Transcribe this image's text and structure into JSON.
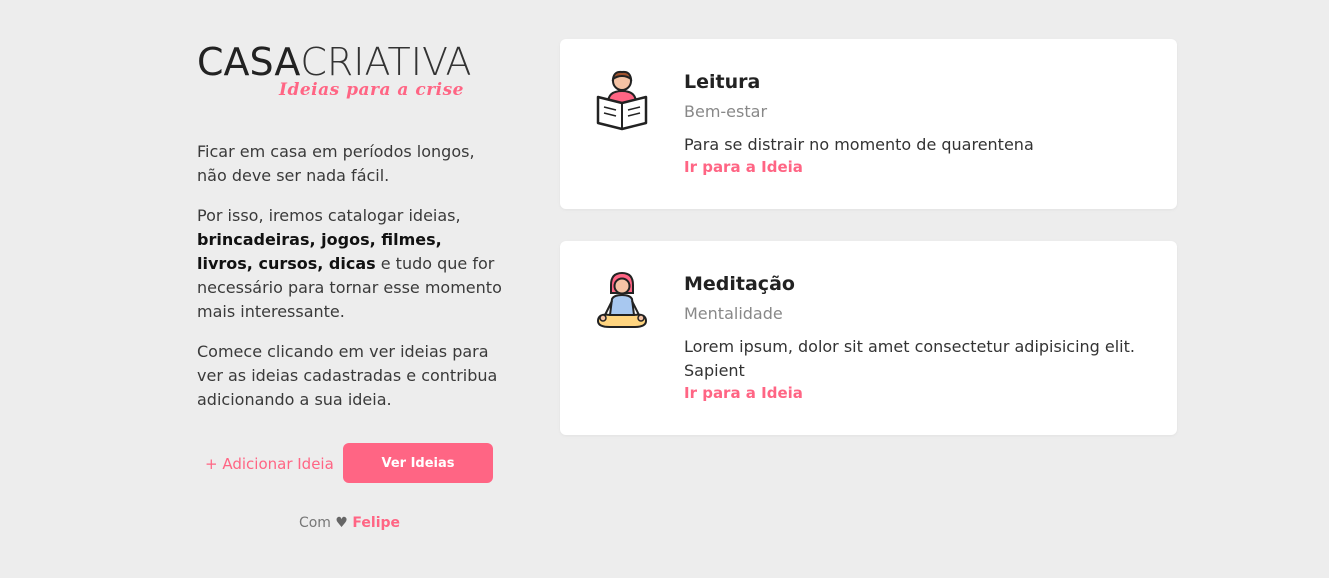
{
  "logo": {
    "bold": "CASA",
    "light": "CRIATIVA",
    "tagline": "Ideias para a crise"
  },
  "intro": {
    "p1": "Ficar em casa em períodos longos, não deve ser nada fácil.",
    "p2_a": "Por isso, iremos catalogar ideias, ",
    "p2_bold": "brincadeiras, jogos, filmes, livros, cursos, dicas",
    "p2_b": " e tudo que for necessário para tornar esse momento mais interessante.",
    "p3": "Comece clicando em ver ideias para ver as ideias cadastradas e contribua adicionando a sua ideia."
  },
  "actions": {
    "add_label": "+ Adicionar Ideia",
    "see_label": "Ver Ideias"
  },
  "footer": {
    "prefix": "Com",
    "heart": "♥",
    "author": "Felipe"
  },
  "ideas": [
    {
      "title": "Leitura",
      "category": "Bem-estar",
      "description": "Para se distrair no momento de quarentena",
      "link": "Ir para a Ideia",
      "icon": "reading-icon"
    },
    {
      "title": "Meditação",
      "category": "Mentalidade",
      "description": "Lorem ipsum, dolor sit amet consectetur adipisicing elit. Sapient",
      "link": "Ir para a Ideia",
      "icon": "meditation-icon"
    }
  ],
  "colors": {
    "accent": "#ff6584",
    "background": "#ededed",
    "card": "#ffffff"
  }
}
